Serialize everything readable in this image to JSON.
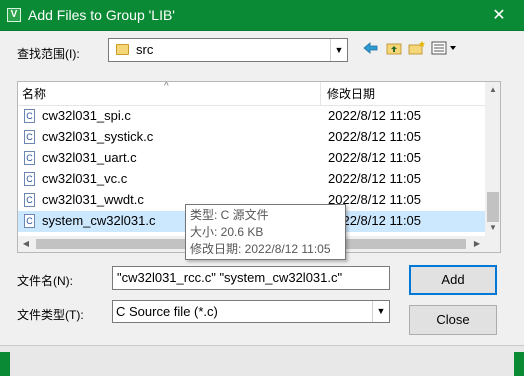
{
  "window": {
    "title": "Add Files to Group 'LIB'",
    "app_icon_glyph": "V",
    "close_glyph": "✕",
    "accent": "#0a8a34"
  },
  "lookin": {
    "label": "查找范围(I):",
    "value": "src",
    "arrow": "▼"
  },
  "toolbar": {
    "back_icon": "back-arrow-icon",
    "up_icon": "up-folder-icon",
    "newfolder_icon": "new-folder-icon",
    "view_icon": "view-menu-icon"
  },
  "list": {
    "col_name": "名称",
    "col_date": "修改日期",
    "sort_glyph": "^",
    "file_icon_glyph": "C",
    "rows": [
      {
        "name": "cw32l031_spi.c",
        "date": "2022/8/12 11:05"
      },
      {
        "name": "cw32l031_systick.c",
        "date": "2022/8/12 11:05"
      },
      {
        "name": "cw32l031_uart.c",
        "date": "2022/8/12 11:05"
      },
      {
        "name": "cw32l031_vc.c",
        "date": "2022/8/12 11:05"
      },
      {
        "name": "cw32l031_wwdt.c",
        "date": "2022/8/12 11:05"
      },
      {
        "name": "system_cw32l031.c",
        "date": "2022/8/12 11:05"
      }
    ],
    "up_arrow": "▲",
    "down_arrow": "▼",
    "left_arrow": "◀",
    "right_arrow": "▶"
  },
  "tooltip": {
    "line1": "类型: C 源文件",
    "line2": "大小: 20.6 KB",
    "line3": "修改日期: 2022/8/12 11:05"
  },
  "filename": {
    "label": "文件名(N):",
    "value": "\"cw32l031_rcc.c\" \"system_cw32l031.c\""
  },
  "filetype": {
    "label": "文件类型(T):",
    "value": "C Source file (*.c)",
    "arrow": "▼"
  },
  "buttons": {
    "add": "Add",
    "close": "Close"
  }
}
